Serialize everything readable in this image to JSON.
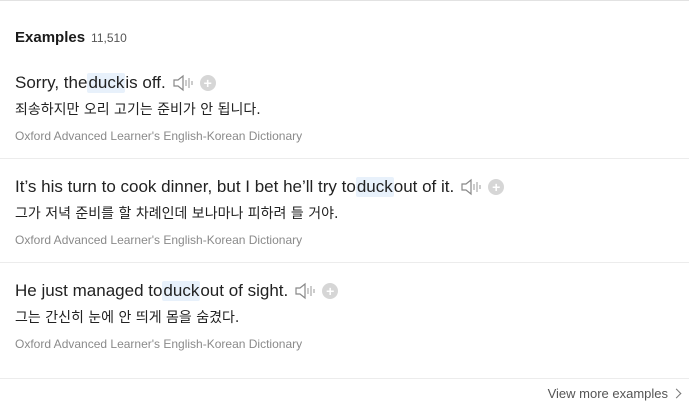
{
  "header": {
    "title": "Examples",
    "count": "11,510"
  },
  "examples": [
    {
      "pre": "Sorry, the ",
      "keyword": "duck",
      "post": " is off.",
      "translation": "죄송하지만 오리 고기는 준비가 안 됩니다.",
      "source": "Oxford Advanced Learner's English-Korean Dictionary",
      "icons": [
        "speaker-icon",
        "plus-icon"
      ]
    },
    {
      "pre": "It’s his turn to cook dinner, but I bet he’ll try to ",
      "keyword": "duck",
      "post": " out of it.",
      "translation": "그가 저녁 준비를 할 차례인데 보나마나 피하려 들 거야.",
      "source": "Oxford Advanced Learner's English-Korean Dictionary",
      "icons": [
        "speaker-icon",
        "plus-icon"
      ]
    },
    {
      "pre": "He just managed to ",
      "keyword": "duck",
      "post": " out of sight.",
      "translation": "그는 간신히 눈에 안 띄게 몸을 숨겼다.",
      "source": "Oxford Advanced Learner's English-Korean Dictionary",
      "icons": [
        "speaker-icon",
        "plus-icon"
      ]
    }
  ],
  "footer": {
    "view_more": "View more examples"
  },
  "colors": {
    "highlight": "#e8f1fb",
    "source_text": "#8a8a8a",
    "plus_bg": "#d6d6d6"
  }
}
